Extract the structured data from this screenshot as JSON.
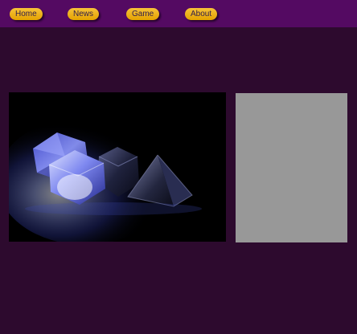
{
  "nav": {
    "items": [
      {
        "label": "Home"
      },
      {
        "label": "News"
      },
      {
        "label": "Game"
      },
      {
        "label": "About"
      }
    ]
  },
  "colors": {
    "page_background": "#2d0a2e",
    "topbar_background": "#540a62",
    "nav_button": "#f0b41a",
    "side_panel": "#989898"
  },
  "hero": {
    "image_icon": "glowing-dice-image"
  }
}
